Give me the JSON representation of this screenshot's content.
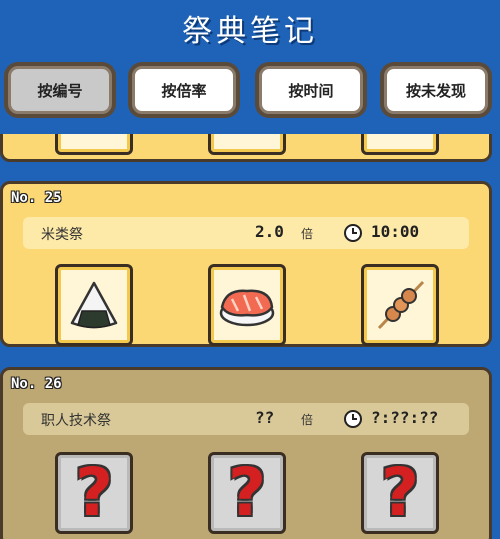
{
  "title": "祭典笔记",
  "sort_buttons": [
    {
      "label": "按编号",
      "active": true
    },
    {
      "label": "按倍率",
      "active": false
    },
    {
      "label": "按时间",
      "active": false
    },
    {
      "label": "按未发现",
      "active": false
    }
  ],
  "cards": [
    {
      "number": "No. 25",
      "name": "米类祭",
      "multiplier": "2.0",
      "multiplier_unit": "倍",
      "time": "10:00",
      "items": [
        "rice-ball-icon",
        "salmon-sushi-icon",
        "dango-skewer-icon"
      ]
    },
    {
      "number": "No. 26",
      "name": "职人技术祭",
      "multiplier": "??",
      "multiplier_unit": "倍",
      "time": "?:??:??",
      "items": [
        "question-mark-icon",
        "question-mark-icon",
        "question-mark-icon"
      ]
    }
  ],
  "colors": {
    "background": "#1f63b8",
    "card_found": "#fbd874",
    "card_unknown": "#bda772",
    "question_mark": "#d42020"
  }
}
